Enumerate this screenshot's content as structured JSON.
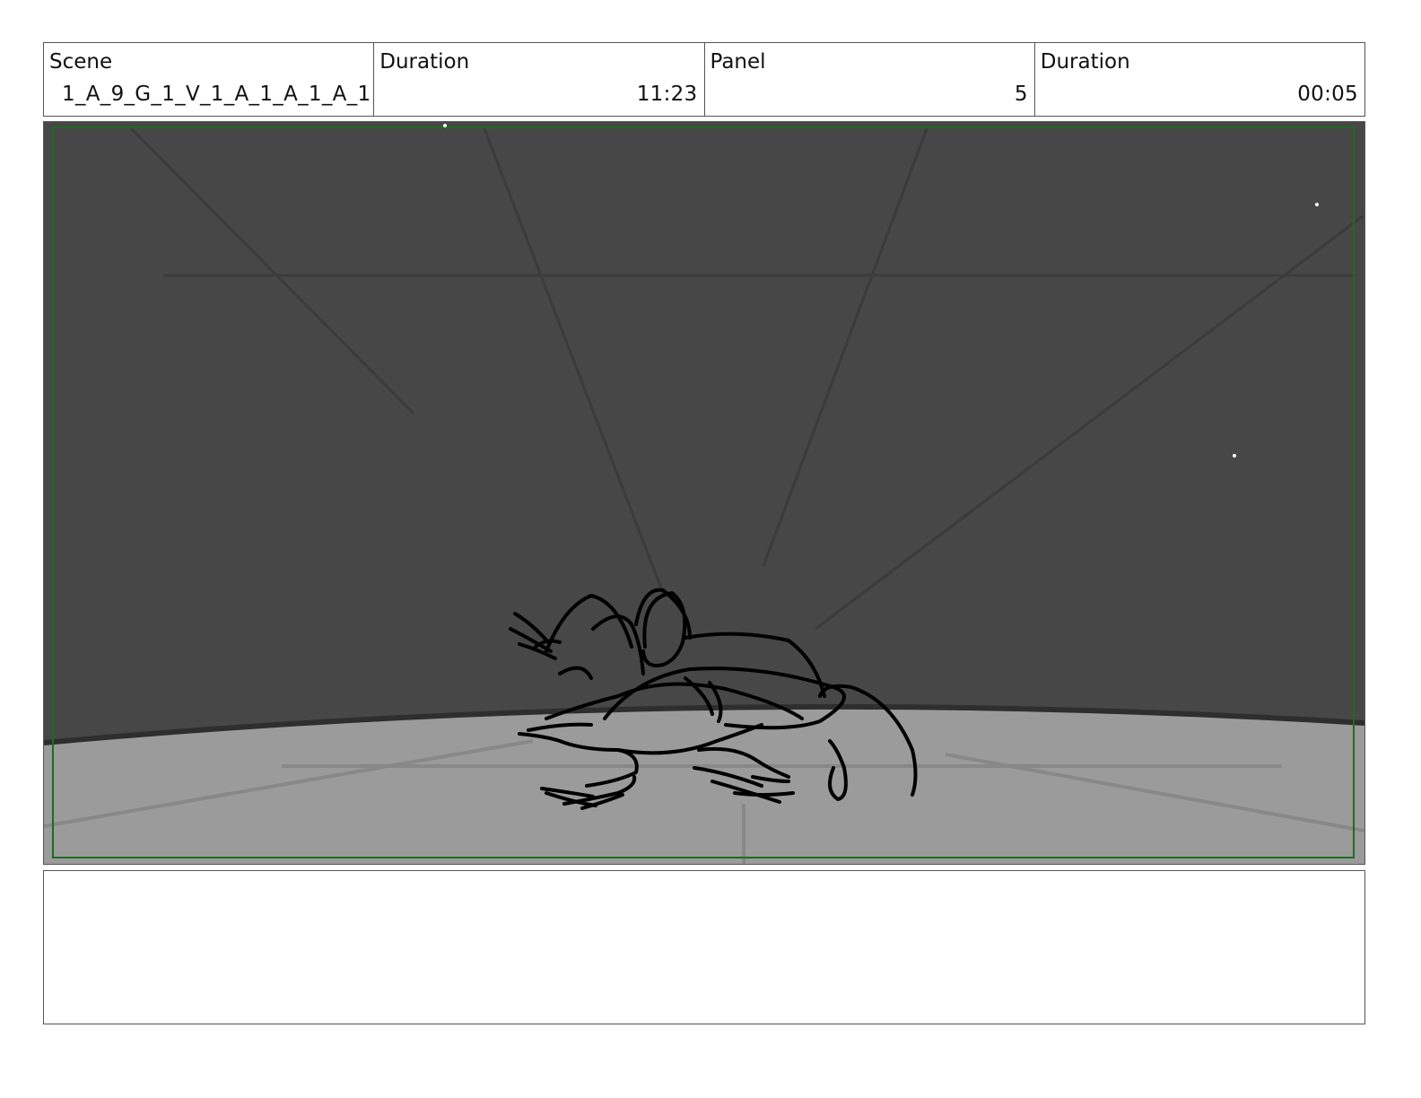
{
  "header": {
    "scene_label": "Scene",
    "scene_value": "1_A_9_G_1_V_1_A_1_A_1_A_1",
    "scene_duration_label": "Duration",
    "scene_duration_value": "11:23",
    "panel_label": "Panel",
    "panel_value": "5",
    "panel_duration_label": "Duration",
    "panel_duration_value": "00:05"
  },
  "panel": {
    "sky_color": "#474747",
    "ground_color": "#9b9b9b",
    "safe_frame_color": "#1f6b1f",
    "ink_color": "#000000"
  },
  "notes": {
    "text": ""
  }
}
